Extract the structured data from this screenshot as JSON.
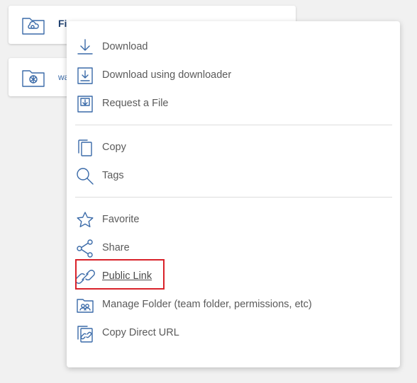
{
  "files": [
    {
      "name": "Fi",
      "icon": "cloud-folder-icon"
    },
    {
      "name": "wa",
      "icon": "aperture-folder-icon"
    }
  ],
  "menu": {
    "items": [
      {
        "label": "Download",
        "icon": "download-icon"
      },
      {
        "label": "Download using downloader",
        "icon": "download-box-icon"
      },
      {
        "label": "Request a File",
        "icon": "request-file-icon"
      },
      {
        "label": "Copy",
        "icon": "copy-icon"
      },
      {
        "label": "Tags",
        "icon": "magnifier-icon"
      },
      {
        "label": "Favorite",
        "icon": "star-icon"
      },
      {
        "label": "Share",
        "icon": "share-icon"
      },
      {
        "label": "Public Link",
        "icon": "link-icon"
      },
      {
        "label": "Manage Folder (team folder, permissions, etc)",
        "icon": "manage-folder-icon"
      },
      {
        "label": "Copy Direct URL",
        "icon": "direct-url-icon"
      }
    ]
  },
  "colors": {
    "accent": "#3a6aa8",
    "highlight": "#d9222a"
  }
}
